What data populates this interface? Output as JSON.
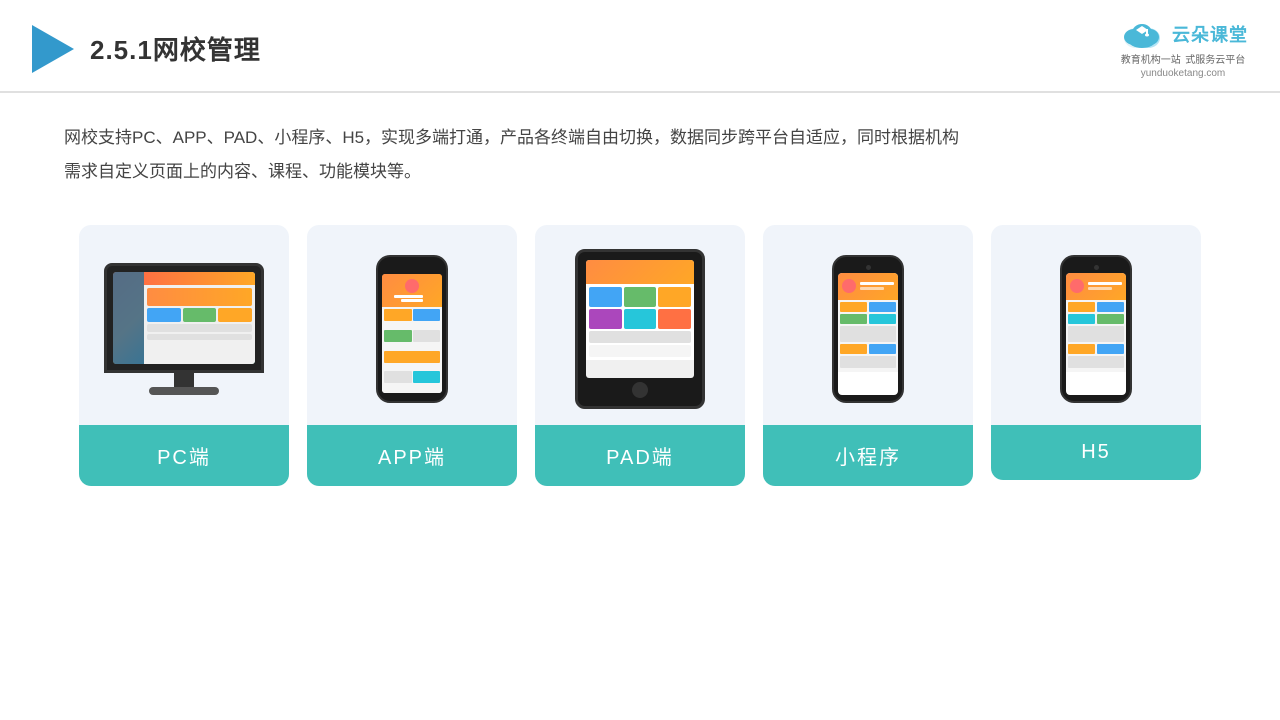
{
  "header": {
    "title": "2.5.1网校管理",
    "brand_name": "云朵课堂",
    "brand_sub1": "教育机构一站",
    "brand_sub2": "式服务云平台",
    "brand_url": "yunduoketang.com"
  },
  "description": {
    "line1": "网校支持PC、APP、PAD、小程序、H5，实现多端打通，产品各终端自由切换，数据同步跨平台自适应，同时根据机构",
    "line2": "需求自定义页面上的内容、课程、功能模块等。"
  },
  "cards": [
    {
      "id": "pc",
      "label": "PC端"
    },
    {
      "id": "app",
      "label": "APP端"
    },
    {
      "id": "pad",
      "label": "PAD端"
    },
    {
      "id": "miniprogram",
      "label": "小程序"
    },
    {
      "id": "h5",
      "label": "H5"
    }
  ]
}
